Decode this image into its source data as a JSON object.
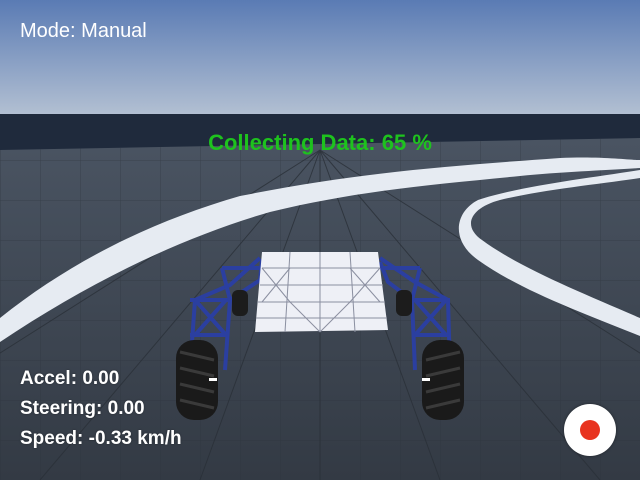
{
  "hud": {
    "mode_label": "Mode:",
    "mode_value": "Manual",
    "collecting_label": "Collecting Data:",
    "collecting_value": "65",
    "collecting_unit": "%",
    "accel_label": "Accel:",
    "accel_value": "0.00",
    "steering_label": "Steering:",
    "steering_value": "0.00",
    "speed_label": "Speed:",
    "speed_value": "-0.33",
    "speed_unit": "km/h"
  },
  "colors": {
    "sky_top": "#5a7bb4",
    "sky_horizon": "#b6c3d4",
    "ground": "#3a4350",
    "curb": "#e6ebf2",
    "collecting_text": "#1ec21e",
    "frame": "#2b3fa0",
    "chassis": "#eef0f6",
    "record_dot": "#e8331f"
  },
  "icons": {
    "record": "record-icon"
  }
}
